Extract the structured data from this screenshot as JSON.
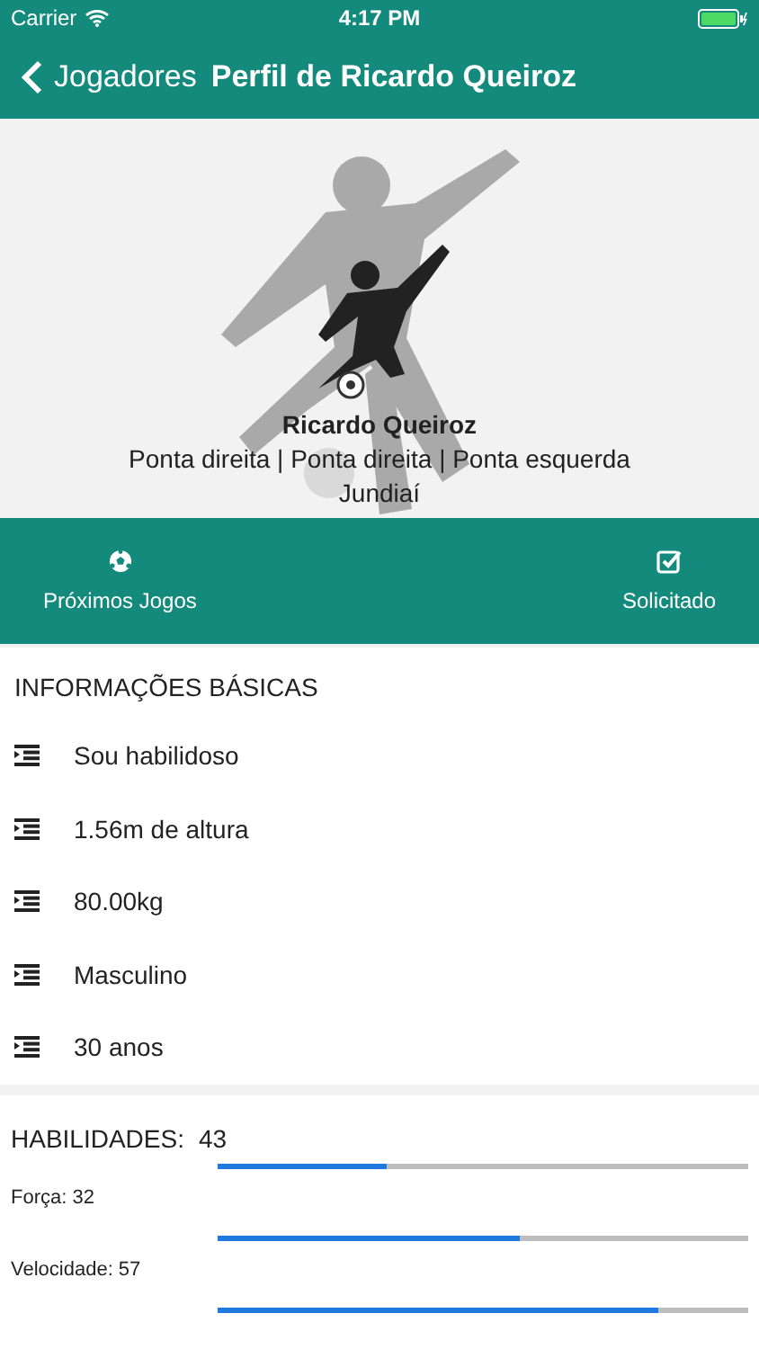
{
  "status_bar": {
    "carrier": "Carrier",
    "time": "4:17 PM"
  },
  "nav": {
    "back": "Jogadores",
    "title": "Perfil de Ricardo Queiroz"
  },
  "profile": {
    "name": "Ricardo Queiroz",
    "positions": "Ponta direita | Ponta direita | Ponta esquerda",
    "city": "Jundiaí"
  },
  "actions": [
    {
      "label": "Próximos Jogos",
      "kind": "ball"
    },
    {
      "label": "Solicitado",
      "kind": "check"
    }
  ],
  "basic_info": {
    "heading": "INFORMAÇÕES BÁSICAS",
    "items": [
      "Sou habilidoso",
      "1.56m de altura",
      "80.00kg",
      "Masculino",
      "30 anos"
    ]
  },
  "skills": {
    "heading": "HABILIDADES:",
    "total": "43",
    "items": [
      {
        "label": "Força: 32",
        "level": 0.32
      },
      {
        "label": "Velocidade: 57",
        "level": 0.57
      },
      {
        "level": 0.83
      }
    ]
  }
}
